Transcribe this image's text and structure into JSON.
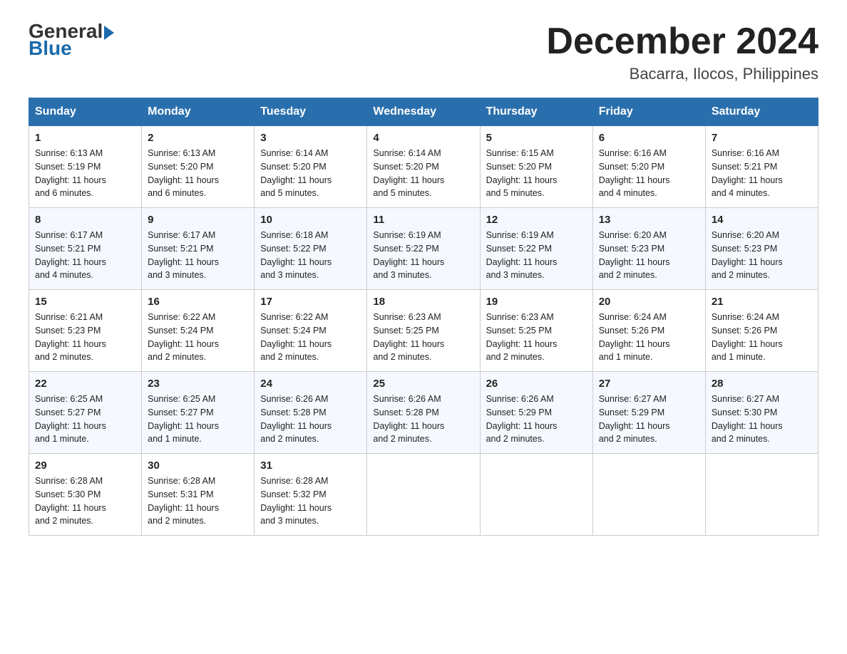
{
  "header": {
    "logo_top": "General",
    "logo_bottom": "Blue",
    "month_title": "December 2024",
    "subtitle": "Bacarra, Ilocos, Philippines"
  },
  "days_of_week": [
    "Sunday",
    "Monday",
    "Tuesday",
    "Wednesday",
    "Thursday",
    "Friday",
    "Saturday"
  ],
  "weeks": [
    [
      {
        "day": "1",
        "sunrise": "6:13 AM",
        "sunset": "5:19 PM",
        "daylight": "11 hours and 6 minutes."
      },
      {
        "day": "2",
        "sunrise": "6:13 AM",
        "sunset": "5:20 PM",
        "daylight": "11 hours and 6 minutes."
      },
      {
        "day": "3",
        "sunrise": "6:14 AM",
        "sunset": "5:20 PM",
        "daylight": "11 hours and 5 minutes."
      },
      {
        "day": "4",
        "sunrise": "6:14 AM",
        "sunset": "5:20 PM",
        "daylight": "11 hours and 5 minutes."
      },
      {
        "day": "5",
        "sunrise": "6:15 AM",
        "sunset": "5:20 PM",
        "daylight": "11 hours and 5 minutes."
      },
      {
        "day": "6",
        "sunrise": "6:16 AM",
        "sunset": "5:20 PM",
        "daylight": "11 hours and 4 minutes."
      },
      {
        "day": "7",
        "sunrise": "6:16 AM",
        "sunset": "5:21 PM",
        "daylight": "11 hours and 4 minutes."
      }
    ],
    [
      {
        "day": "8",
        "sunrise": "6:17 AM",
        "sunset": "5:21 PM",
        "daylight": "11 hours and 4 minutes."
      },
      {
        "day": "9",
        "sunrise": "6:17 AM",
        "sunset": "5:21 PM",
        "daylight": "11 hours and 3 minutes."
      },
      {
        "day": "10",
        "sunrise": "6:18 AM",
        "sunset": "5:22 PM",
        "daylight": "11 hours and 3 minutes."
      },
      {
        "day": "11",
        "sunrise": "6:19 AM",
        "sunset": "5:22 PM",
        "daylight": "11 hours and 3 minutes."
      },
      {
        "day": "12",
        "sunrise": "6:19 AM",
        "sunset": "5:22 PM",
        "daylight": "11 hours and 3 minutes."
      },
      {
        "day": "13",
        "sunrise": "6:20 AM",
        "sunset": "5:23 PM",
        "daylight": "11 hours and 2 minutes."
      },
      {
        "day": "14",
        "sunrise": "6:20 AM",
        "sunset": "5:23 PM",
        "daylight": "11 hours and 2 minutes."
      }
    ],
    [
      {
        "day": "15",
        "sunrise": "6:21 AM",
        "sunset": "5:23 PM",
        "daylight": "11 hours and 2 minutes."
      },
      {
        "day": "16",
        "sunrise": "6:22 AM",
        "sunset": "5:24 PM",
        "daylight": "11 hours and 2 minutes."
      },
      {
        "day": "17",
        "sunrise": "6:22 AM",
        "sunset": "5:24 PM",
        "daylight": "11 hours and 2 minutes."
      },
      {
        "day": "18",
        "sunrise": "6:23 AM",
        "sunset": "5:25 PM",
        "daylight": "11 hours and 2 minutes."
      },
      {
        "day": "19",
        "sunrise": "6:23 AM",
        "sunset": "5:25 PM",
        "daylight": "11 hours and 2 minutes."
      },
      {
        "day": "20",
        "sunrise": "6:24 AM",
        "sunset": "5:26 PM",
        "daylight": "11 hours and 1 minute."
      },
      {
        "day": "21",
        "sunrise": "6:24 AM",
        "sunset": "5:26 PM",
        "daylight": "11 hours and 1 minute."
      }
    ],
    [
      {
        "day": "22",
        "sunrise": "6:25 AM",
        "sunset": "5:27 PM",
        "daylight": "11 hours and 1 minute."
      },
      {
        "day": "23",
        "sunrise": "6:25 AM",
        "sunset": "5:27 PM",
        "daylight": "11 hours and 1 minute."
      },
      {
        "day": "24",
        "sunrise": "6:26 AM",
        "sunset": "5:28 PM",
        "daylight": "11 hours and 2 minutes."
      },
      {
        "day": "25",
        "sunrise": "6:26 AM",
        "sunset": "5:28 PM",
        "daylight": "11 hours and 2 minutes."
      },
      {
        "day": "26",
        "sunrise": "6:26 AM",
        "sunset": "5:29 PM",
        "daylight": "11 hours and 2 minutes."
      },
      {
        "day": "27",
        "sunrise": "6:27 AM",
        "sunset": "5:29 PM",
        "daylight": "11 hours and 2 minutes."
      },
      {
        "day": "28",
        "sunrise": "6:27 AM",
        "sunset": "5:30 PM",
        "daylight": "11 hours and 2 minutes."
      }
    ],
    [
      {
        "day": "29",
        "sunrise": "6:28 AM",
        "sunset": "5:30 PM",
        "daylight": "11 hours and 2 minutes."
      },
      {
        "day": "30",
        "sunrise": "6:28 AM",
        "sunset": "5:31 PM",
        "daylight": "11 hours and 2 minutes."
      },
      {
        "day": "31",
        "sunrise": "6:28 AM",
        "sunset": "5:32 PM",
        "daylight": "11 hours and 3 minutes."
      },
      null,
      null,
      null,
      null
    ]
  ],
  "labels": {
    "sunrise": "Sunrise:",
    "sunset": "Sunset:",
    "daylight": "Daylight:"
  }
}
